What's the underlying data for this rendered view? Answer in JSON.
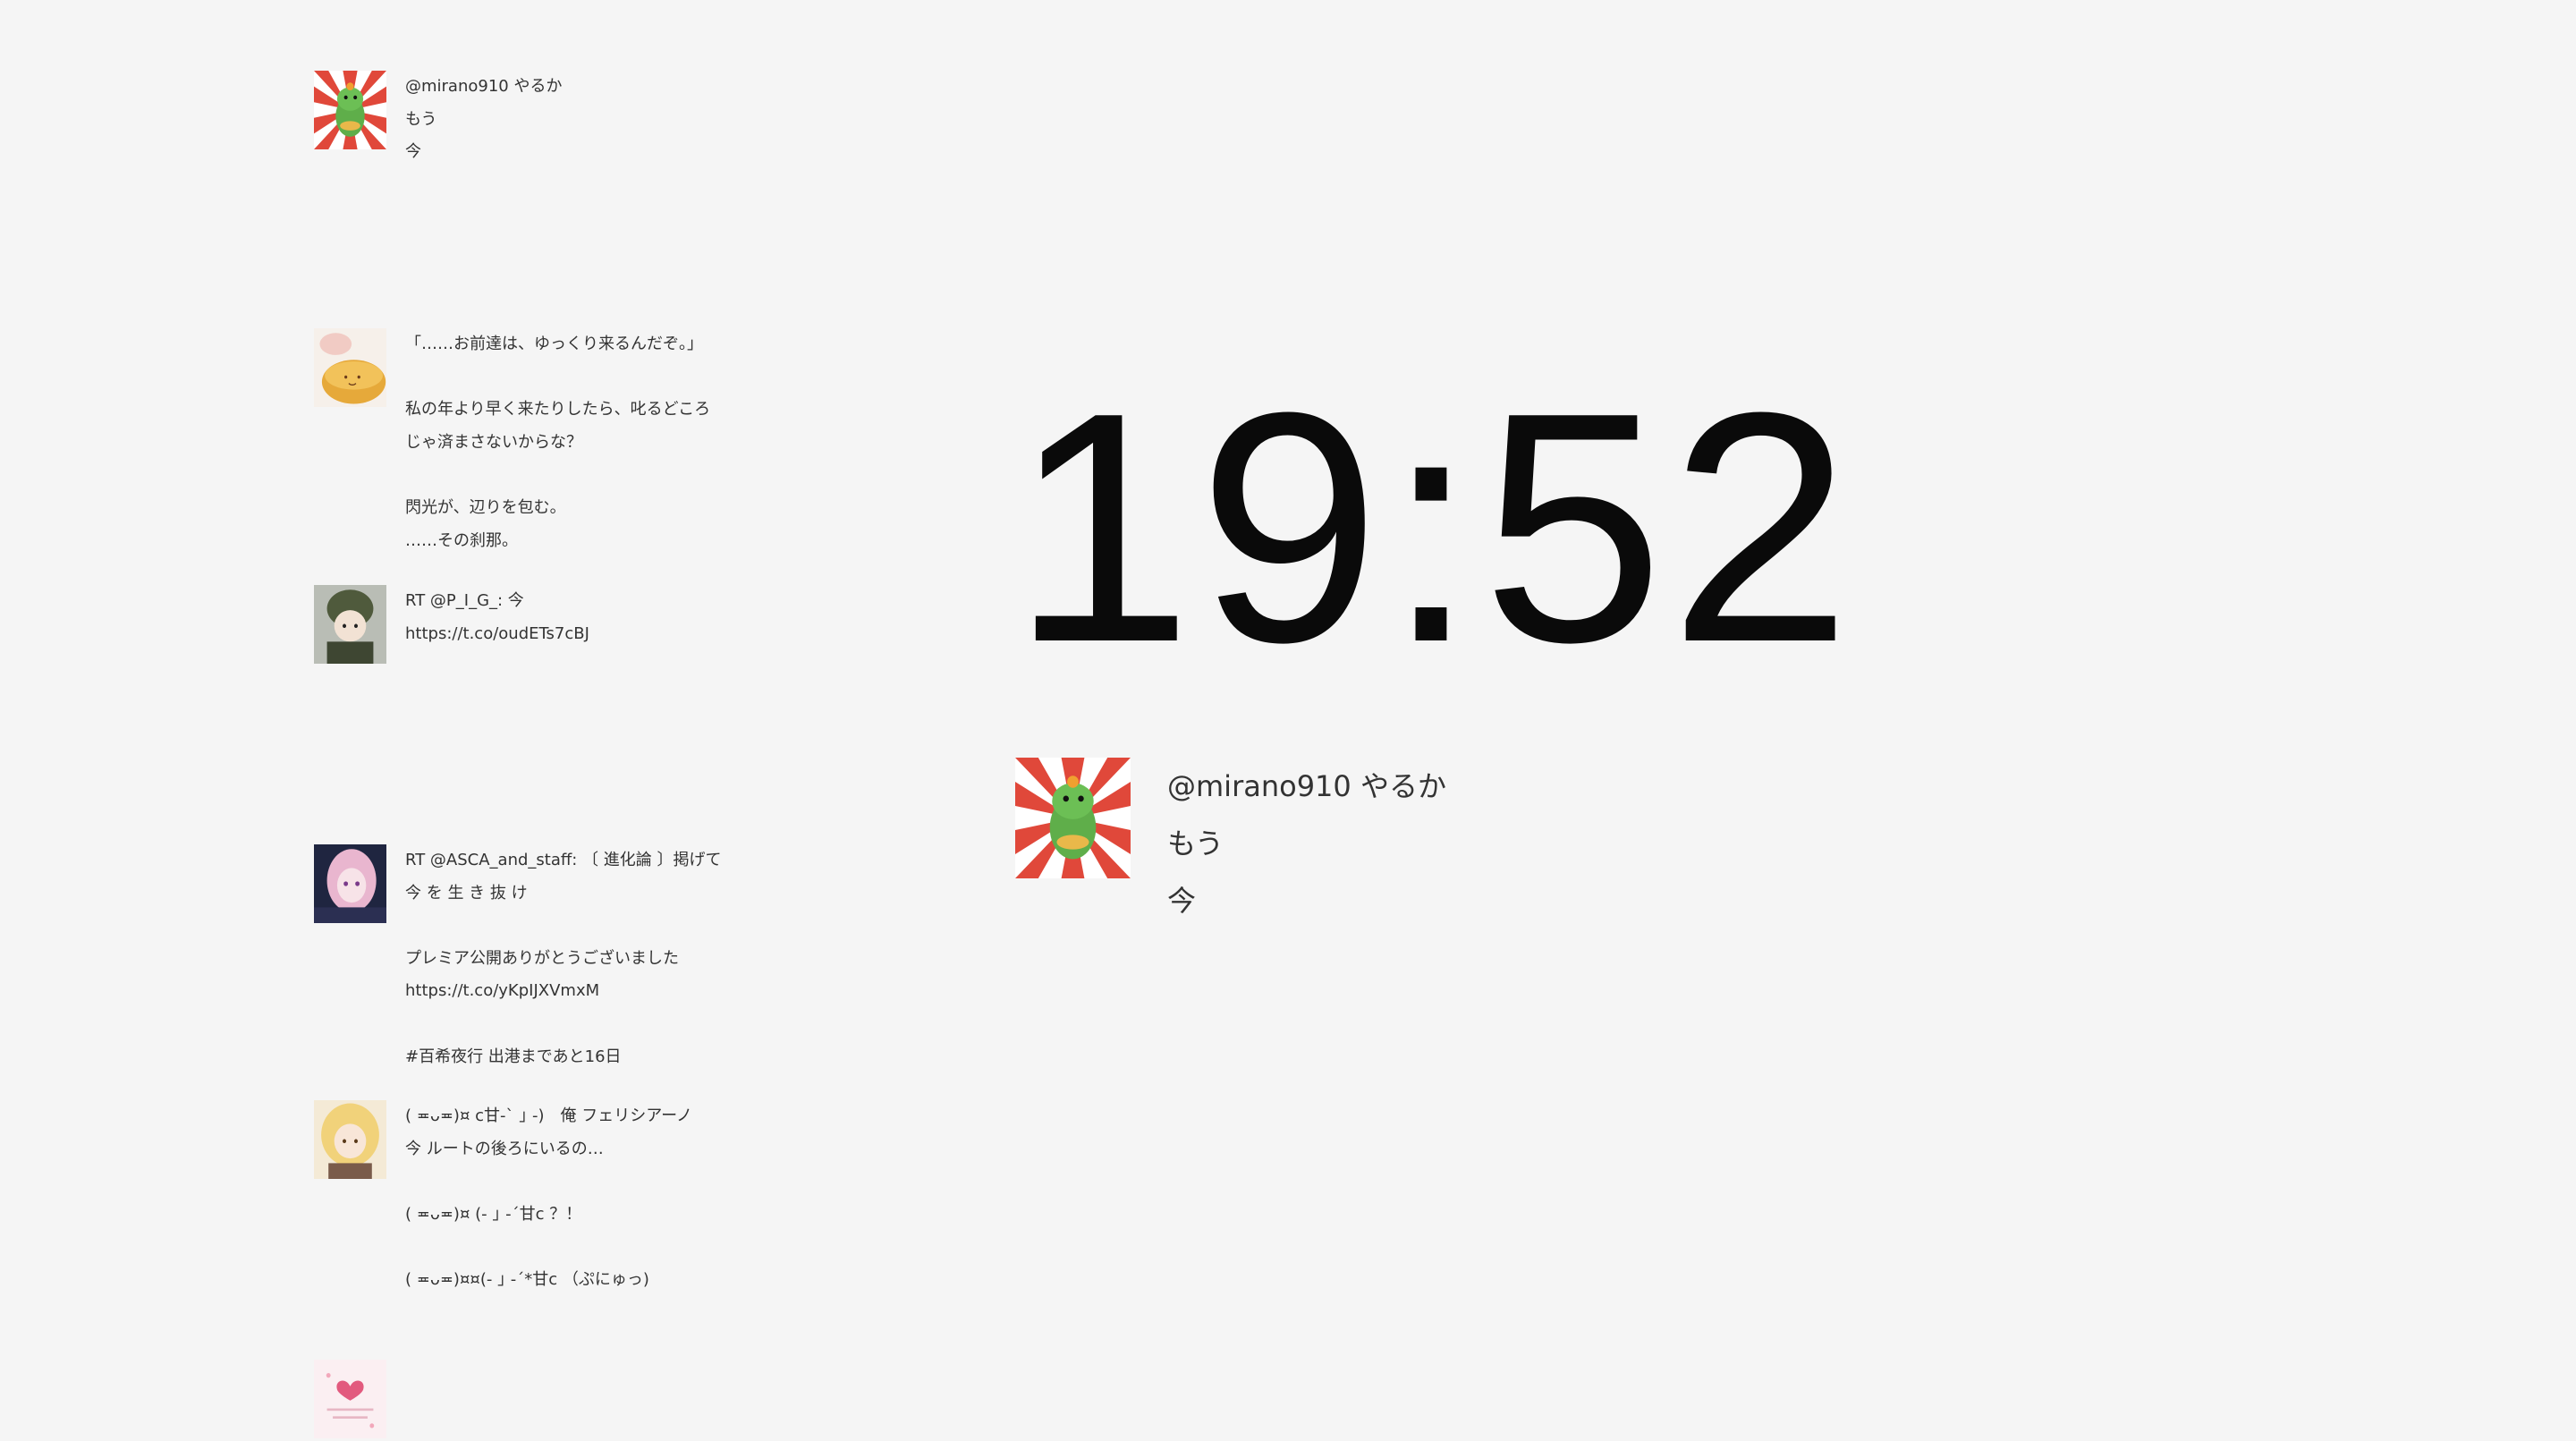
{
  "clock": {
    "time": "19:52"
  },
  "featured_tweet": {
    "lines": [
      "@mirano910 やるか",
      "もう",
      "今"
    ],
    "avatar_icon": "dragon-avatar-icon"
  },
  "feed": {
    "tweets": [
      {
        "avatar_icon": "dragon-avatar-icon",
        "lines": [
          "@mirano910 やるか",
          "もう",
          "今"
        ]
      },
      {
        "avatar_icon": "food-avatar-icon",
        "lines": [
          "「……お前達は、ゆっくり来るんだぞ。」",
          "",
          "私の年より早く来たりしたら、叱るどころ",
          "じゃ済まさないからな？",
          "",
          "閃光が、辺りを包む。",
          "……その刹那。"
        ]
      },
      {
        "avatar_icon": "soldier-avatar-icon",
        "lines": [
          "RT @P_I_G_: 今",
          "https://t.co/oudETs7cBJ"
        ]
      },
      {
        "avatar_icon": "anime-girl-avatar-icon",
        "lines": [
          "RT @ASCA_and_staff: 〔 進化論 〕掲げて",
          "今 を 生 き 抜 け",
          "",
          "プレミア公開ありがとうございました",
          "https://t.co/yKpIJXVmxM",
          "",
          "#百希夜行 出港まであと16日"
        ]
      },
      {
        "avatar_icon": "blonde-girl-avatar-icon",
        "lines": [
          "( ≖ᴗ≖)¤ c甘-ˋ ｣ -)　俺 フェリシアーノ",
          "今 ルートの後ろにいるの…",
          "",
          "( ≖ᴗ≖)¤ (- ｣ -ˊ甘c ？！",
          "",
          "( ≖ᴗ≖)¤¤(- ｣ -ˊ*甘c （ぷにゅっ)"
        ]
      },
      {
        "avatar_icon": "heart-card-avatar-icon",
        "lines": []
      }
    ]
  },
  "colors": {
    "background": "#f5f5f5",
    "dragon_green": "#5fae4a",
    "sunburst_red": "#e0483a"
  }
}
